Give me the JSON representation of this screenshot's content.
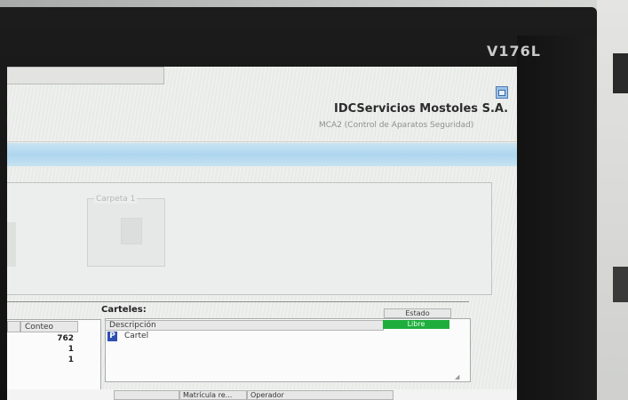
{
  "monitor": {
    "model": "V176L"
  },
  "header": {
    "company": "IDCServicios Mostoles S.A.",
    "subtitle": "MCA2 (Control de Aparatos Seguridad)"
  },
  "panel": {
    "inner_label": "Carpeta 1"
  },
  "left_list": {
    "column": "Conteo",
    "values": [
      "762",
      "1",
      "1"
    ]
  },
  "carteles": {
    "title": "Carteles:",
    "col_descripcion": "Descripción",
    "col_estado": "Estado",
    "rows": [
      {
        "icon": "P",
        "descripcion": "Cartel",
        "estado": "Libre"
      }
    ],
    "colors": {
      "estado_libre": "#1fae3e"
    }
  },
  "bottom_table": {
    "columns": [
      "Matrícula re...",
      "Operador"
    ]
  }
}
